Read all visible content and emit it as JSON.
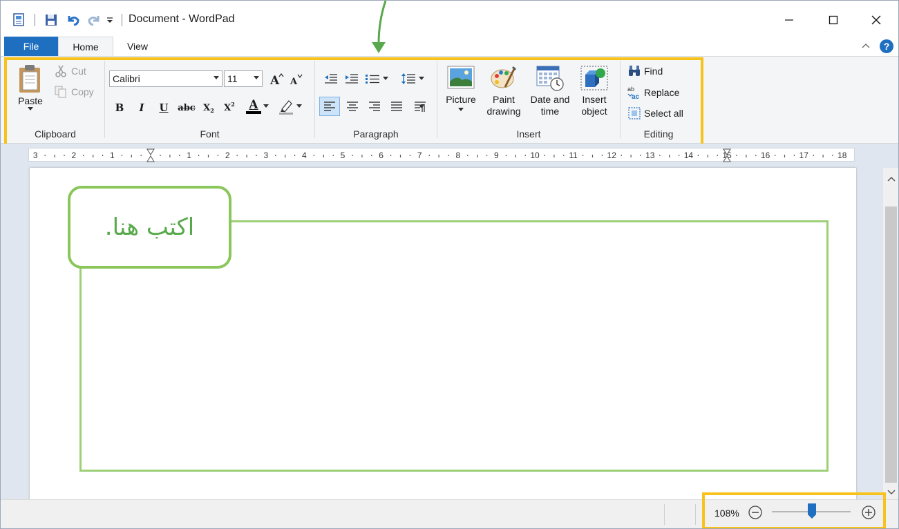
{
  "window": {
    "title": "Document - WordPad",
    "controls": {
      "minimize": "—",
      "maximize": "☐",
      "close": "✕"
    }
  },
  "tabs": [
    {
      "label": "File",
      "active": false
    },
    {
      "label": "Home",
      "active": true
    },
    {
      "label": "View",
      "active": false
    }
  ],
  "ribbon": {
    "clipboard": {
      "label": "Clipboard",
      "paste": "Paste",
      "cut": "Cut",
      "copy": "Copy"
    },
    "font": {
      "label": "Font",
      "family": "Calibri",
      "size": "11",
      "bold": "B",
      "italic": "I",
      "underline": "U",
      "strike": "abc",
      "subscript_base": "X",
      "subscript_mark": "2",
      "superscript_base": "X",
      "superscript_mark": "2",
      "color_glyph": "A"
    },
    "paragraph": {
      "label": "Paragraph"
    },
    "insert": {
      "label": "Insert",
      "picture": "Picture",
      "paint_line1": "Paint",
      "paint_line2": "drawing",
      "datetime_line1": "Date and",
      "datetime_line2": "time",
      "object_line1": "Insert",
      "object_line2": "object"
    },
    "editing": {
      "label": "Editing",
      "find": "Find",
      "replace": "Replace",
      "select_all": "Select all"
    }
  },
  "ruler": {
    "labels": [
      "3",
      "2",
      "1",
      "1",
      "2",
      "3",
      "4",
      "5",
      "6",
      "7",
      "8",
      "9",
      "10",
      "11",
      "12",
      "13",
      "14",
      "15",
      "16",
      "17",
      "18"
    ]
  },
  "document": {
    "callout_text": "اكتب هنا."
  },
  "status": {
    "zoom_percent": "108%",
    "zoom_minus": "−",
    "zoom_plus": "+",
    "zoom_level": 0.5
  },
  "colors": {
    "accent": "#1f6fc0",
    "highlight": "#f7c21b",
    "callout_green": "#58a94b"
  }
}
